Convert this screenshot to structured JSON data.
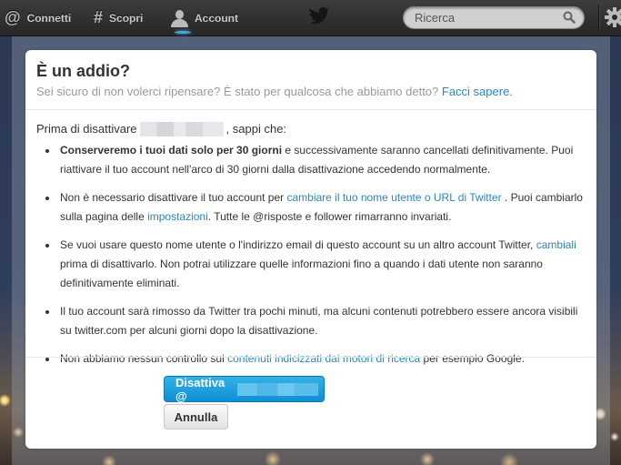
{
  "topbar": {
    "nav": [
      {
        "label": "Connetti",
        "icon": "at-icon"
      },
      {
        "label": "Scopri",
        "icon": "hashtag-icon"
      },
      {
        "label": "Account",
        "icon": "person-icon",
        "active": true
      }
    ],
    "logo": "twitter-bird-icon",
    "search": {
      "placeholder": "Ricerca",
      "value": ""
    },
    "settings_icon": "gear-icon",
    "accent_color": "#4aa8e0"
  },
  "modal": {
    "title": "È un addio?",
    "subtitle": "Sei sicuro di non volerci ripensare? È stato per qualcosa che abbiamo detto?",
    "subtitle_link": "Facci sapere.",
    "intro_before": "Prima di disattivare",
    "intro_after": ", sappi che:",
    "bullets": [
      {
        "bold": "Conserveremo i tuoi dati solo per 30 giorni",
        "text": " e successivamente saranno cancellati definitivamente. Puoi riattivare il tuo account nell'arco di 30 giorni dalla disattivazione accedendo normalmente."
      },
      {
        "text1": "Non è necessario disattivare il tuo account per ",
        "link1": "cambiare il tuo nome utente o URL di Twitter",
        "text2": " . Puoi cambiarlo sulla pagina delle ",
        "link2": "impostazioni",
        "text3": ". Tutte le @risposte e follower rimarranno invariati."
      },
      {
        "text1": "Se vuoi usare questo nome utente o l'indirizzo email di questo account su un altro account Twitter, ",
        "link1": "cambiali",
        "text2": " prima di disattivarlo. Non potrai utilizzare quelle informazioni fino a quando i dati utente non saranno definitivamente eliminati."
      },
      {
        "text": "Il tuo account sarà rimosso da Twitter tra pochi minuti, ma alcuni contenuti potrebbero essere ancora visibili su twitter.com per alcuni giorni dopo la disattivazione."
      },
      {
        "text1": "Non abbiamo nessun controllo sui ",
        "link1": "contenuti indicizzati dai motori di ricerca",
        "text2": " per esempio Google."
      }
    ],
    "buttons": {
      "deactivate_label": "Disattiva @",
      "cancel_label": "Annulla"
    },
    "link_color": "#2a86b8",
    "primary_color": "#1d9ddc"
  }
}
